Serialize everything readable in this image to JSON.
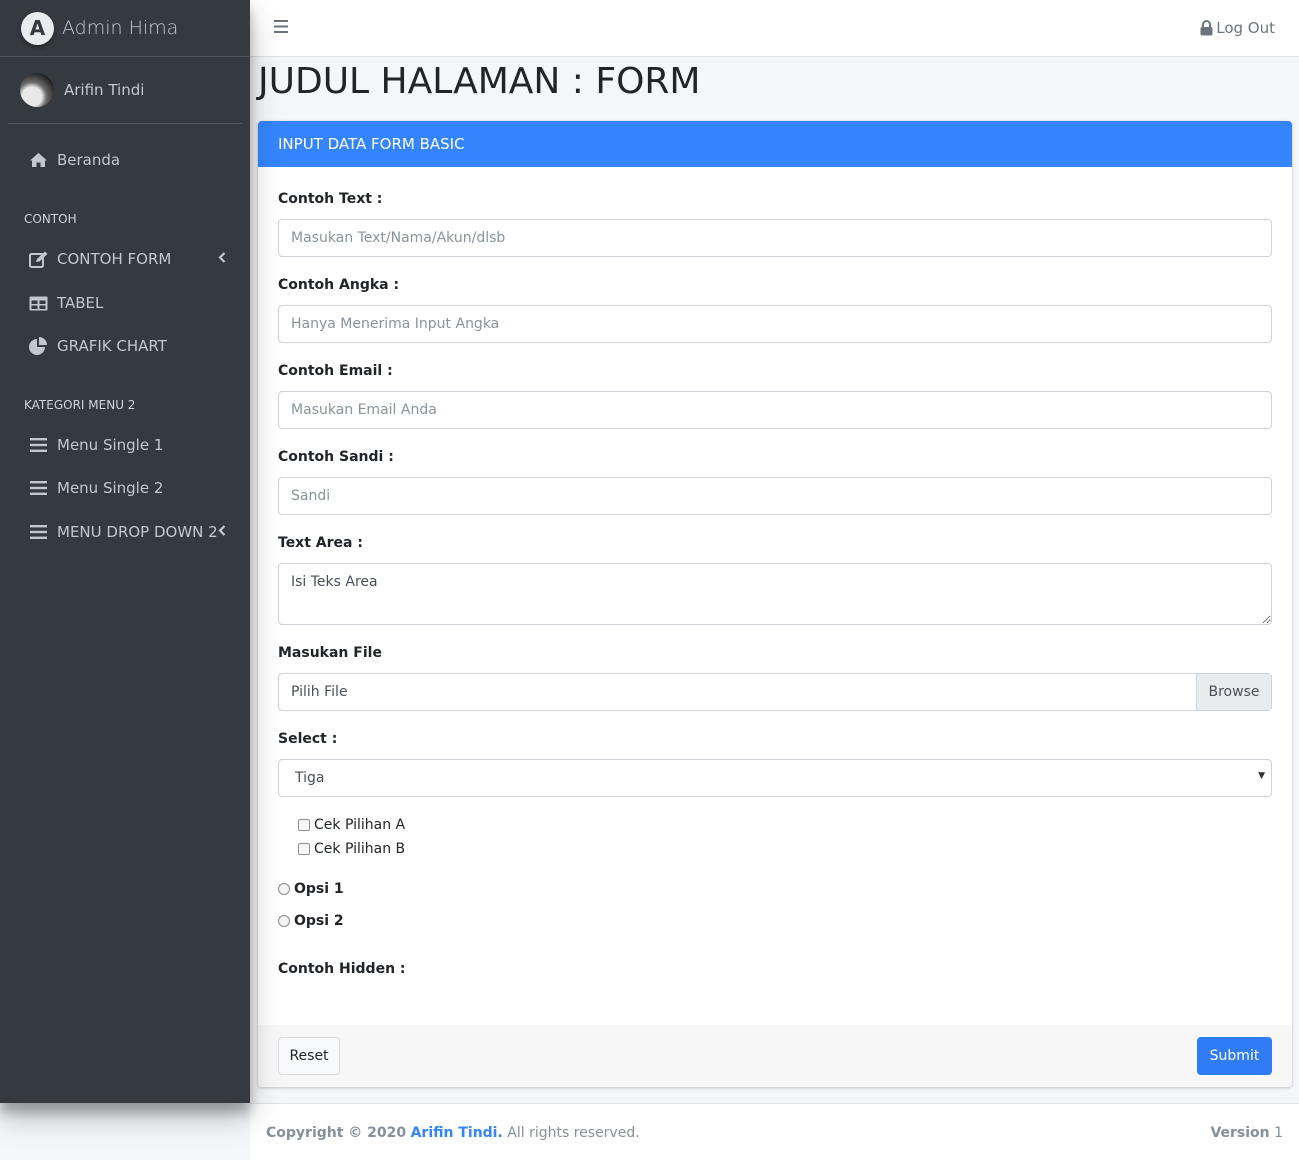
{
  "brand": {
    "logo_letter": "A",
    "name": "Admin Hima"
  },
  "user": {
    "name": "Arifin Tindi"
  },
  "sidebar": {
    "home": {
      "label": "Beranda",
      "icon": "home-icon"
    },
    "section1_header": "CONTOH",
    "items": [
      {
        "label": "CONTOH FORM",
        "icon": "edit-icon",
        "has_caret": true
      },
      {
        "label": "TABEL",
        "icon": "table-icon"
      },
      {
        "label": "GRAFIK CHART",
        "icon": "pie-chart-icon"
      }
    ],
    "section2_header": "KATEGORI MENU 2",
    "items2": [
      {
        "label": "Menu Single 1",
        "icon": "bars-icon"
      },
      {
        "label": "Menu Single 2",
        "icon": "bars-icon"
      },
      {
        "label": "MENU DROP DOWN 2",
        "icon": "bars-icon",
        "has_caret": true
      }
    ]
  },
  "topbar": {
    "logout_label": "Log Out"
  },
  "page": {
    "title": "JUDUL HALAMAN : FORM"
  },
  "card": {
    "header": "INPUT DATA FORM BASIC",
    "header_color": "#3485fd",
    "fields": {
      "text_label": "Contoh Text :",
      "text_placeholder": "Masukan Text/Nama/Akun/dlsb",
      "number_label": "Contoh Angka :",
      "number_placeholder": "Hanya Menerima Input Angka",
      "email_label": "Contoh Email :",
      "email_placeholder": "Masukan Email Anda",
      "password_label": "Contoh Sandi :",
      "password_placeholder": "Sandi",
      "textarea_label": "Text Area :",
      "textarea_value": "Isi Teks Area",
      "file_label": "Masukan File",
      "file_value": "Pilih File",
      "file_browse": "Browse",
      "select_label": "Select :",
      "select_value": "Tiga",
      "check_a": "Cek Pilihan A",
      "check_b": "Cek Pilihan B",
      "radio_1": "Opsi 1",
      "radio_2": "Opsi 2",
      "hidden_label": "Contoh Hidden :"
    },
    "reset_label": "Reset",
    "submit_label": "Submit",
    "submit_color": "#2f7cf6"
  },
  "footer": {
    "copyright_prefix": "Copyright © 2020",
    "author": "Arifin Tindi.",
    "rights": "All rights reserved.",
    "version_label": "Version",
    "version_value": "1"
  }
}
